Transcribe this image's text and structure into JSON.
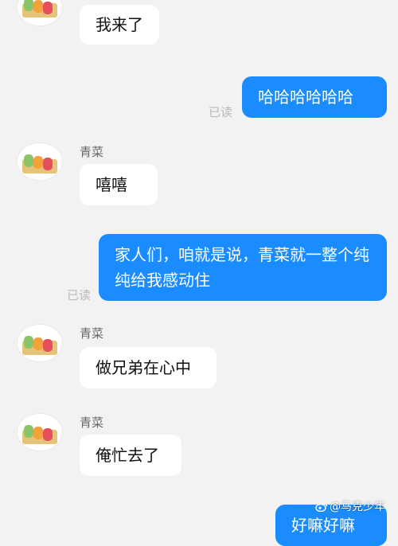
{
  "messages": [
    {
      "side": "in",
      "name": "",
      "text": "我来了"
    },
    {
      "side": "out",
      "text": "哈哈哈哈哈哈",
      "read": "已读"
    },
    {
      "side": "in",
      "name": "青菜",
      "text": "嘻嘻"
    },
    {
      "side": "out",
      "text": "家人们，咱就是说，青菜就一整个纯纯给我感动住",
      "read": "已读"
    },
    {
      "side": "in",
      "name": "青菜",
      "text": "做兄弟在心中"
    },
    {
      "side": "in",
      "name": "青菜",
      "text": "俺忙去了"
    },
    {
      "side": "out",
      "text": "好嘛好嘛"
    }
  ],
  "watermark": "@马克少年",
  "colors": {
    "outgoing": "#1a8cff",
    "incoming": "#ffffff",
    "background": "#f2f2f2",
    "read": "#b9b9b9"
  }
}
